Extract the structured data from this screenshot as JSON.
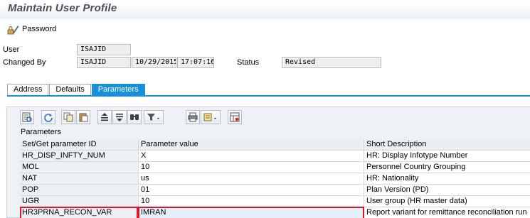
{
  "window": {
    "title": "Maintain User Profile"
  },
  "toolbar": {
    "password_label": "Password"
  },
  "header_fields": {
    "user_label": "User",
    "user_value": "ISAJID",
    "changed_by_label": "Changed By",
    "changed_by_value": "ISAJID",
    "changed_date": "10/29/2015",
    "changed_time": "17:07:16",
    "status_label": "Status",
    "status_value": "Revised"
  },
  "tabs": [
    {
      "label": "Address",
      "active": false
    },
    {
      "label": "Defaults",
      "active": false
    },
    {
      "label": "Parameters",
      "active": true
    }
  ],
  "grid": {
    "caption": "Parameters",
    "toolbar_icons": [
      "details-icon",
      "refresh-icon",
      "copy-icon",
      "paste-icon",
      "sort-ascending-icon",
      "sort-descending-icon",
      "find-icon",
      "filter-icon",
      "print-icon",
      "export-icon",
      "layout-icon"
    ],
    "columns": [
      "Set/Get parameter ID",
      "Parameter value",
      "Short Description"
    ],
    "rows": [
      [
        "HR_DISP_INFTY_NUM",
        "X",
        "HR: Display Infotype Number"
      ],
      [
        "MOL",
        "10",
        "Personnel Country Grouping"
      ],
      [
        "NAT",
        "us",
        "HR: Nationality"
      ],
      [
        "POP",
        "01",
        "Plan Version (PD)"
      ],
      [
        "UGR",
        "10",
        "User group (HR master data)"
      ],
      [
        "HR3PRNA_RECON_VAR",
        "IMRAN",
        "Report variant for remittance reconciliation run"
      ]
    ]
  },
  "colors": {
    "accent": "#1a8fd8",
    "highlight": "#e0142b"
  }
}
